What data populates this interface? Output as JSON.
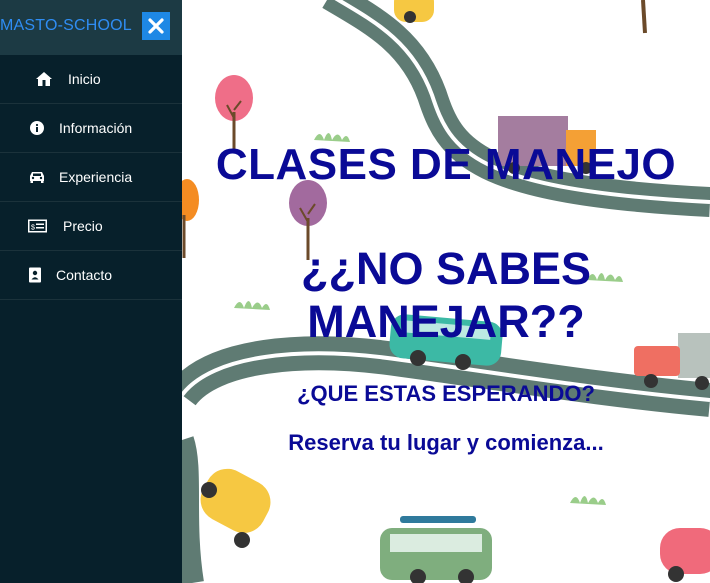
{
  "brand": {
    "name": "MASTO-SCHOOL"
  },
  "menu": [
    {
      "label": "Inicio",
      "icon": "home-icon"
    },
    {
      "label": "Información",
      "icon": "info-icon"
    },
    {
      "label": "Experiencia",
      "icon": "car-icon"
    },
    {
      "label": "Precio",
      "icon": "money-bill-icon"
    },
    {
      "label": "Contacto",
      "icon": "contact-card-icon"
    }
  ],
  "hero": {
    "title": "CLASES DE MANEJO",
    "question": "¿¿NO SABES MANEJAR??",
    "subtitle": "¿QUE ESTAS ESPERANDO?",
    "cta": "Reserva tu lugar y comienza..."
  },
  "colors": {
    "sidebar_bg": "#07202b",
    "sidebar_header_bg": "#1c3a44",
    "brand": "#2f8df4",
    "close_button": "#1e88e5",
    "hero_text": "#0a0a96",
    "road": "#5f7b73"
  }
}
